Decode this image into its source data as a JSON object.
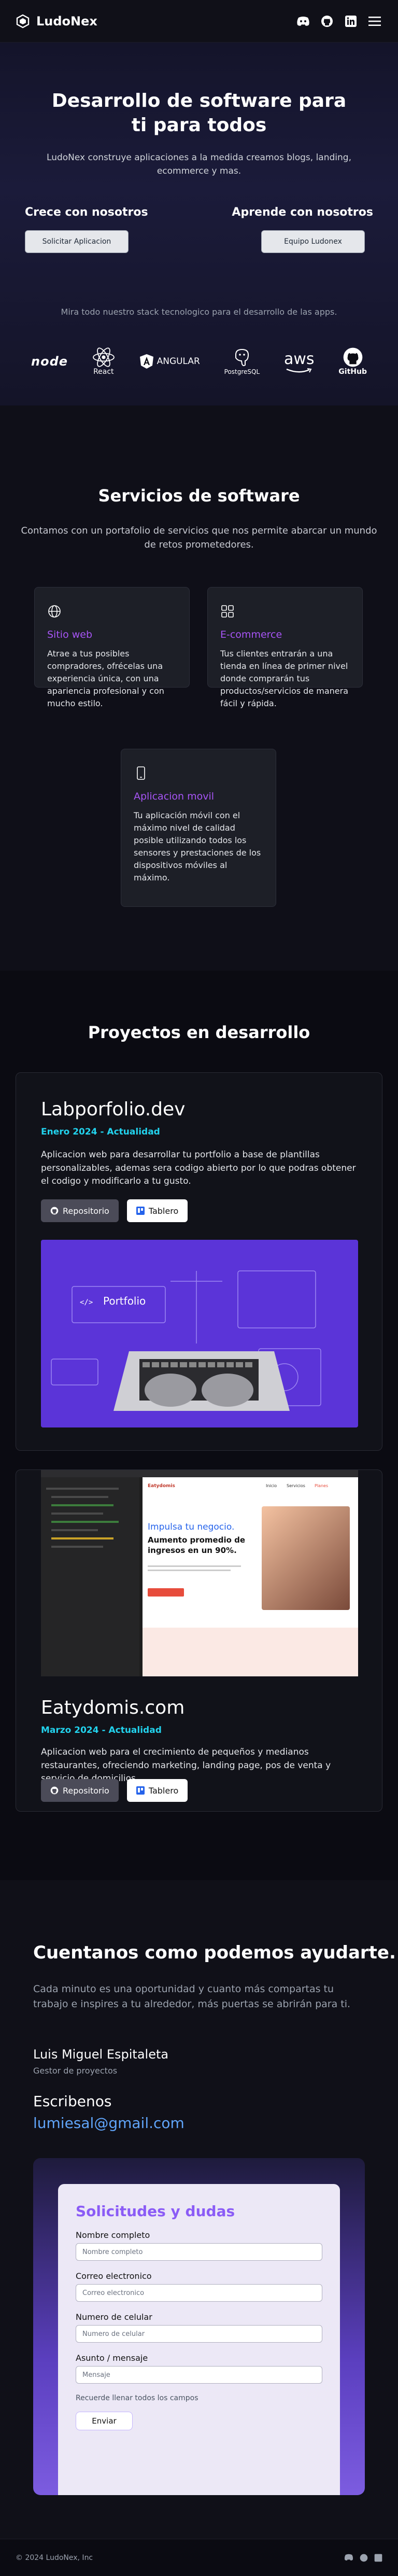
{
  "header": {
    "brand": "LudoNex",
    "icons": [
      "discord-icon",
      "github-icon",
      "linkedin-icon",
      "menu-icon"
    ]
  },
  "hero": {
    "title": "Desarrollo de software para ti para todos",
    "subtitle": "LudoNex construye aplicaciones a la medida creamos blogs, landing, ecommerce y mas.",
    "cta_left_title": "Crece con nosotros",
    "cta_left_button": "Solicitar Aplicacion",
    "cta_right_title": "Aprende con nosotros",
    "cta_right_button": "Equipo Ludonex",
    "stack_caption": "Mira todo nuestro stack tecnologico para el desarrollo de las apps.",
    "logos": [
      "node",
      "React",
      "ANGULAR",
      "PostgreSQL",
      "aws",
      "GitHub"
    ]
  },
  "services": {
    "title": "Servicios de software",
    "subtitle": "Contamos con un portafolio de servicios que nos permite abarcar un mundo de retos prometedores.",
    "items": [
      {
        "name": "Sitio web",
        "icon": "globe-icon",
        "desc": "Atrae a tus posibles compradores, ofrécelas una experiencia única, con una apariencia profesional y con mucho estilo."
      },
      {
        "name": "E-commerce",
        "icon": "grid-icon",
        "desc": "Tus clientes entrarán a una tienda en línea de primer nivel donde comprarán tus productos/servicios de manera fácil y rápida."
      },
      {
        "name": "Aplicacion movil",
        "icon": "phone-icon",
        "desc": "Tu aplicación móvil con el máximo nivel de calidad posible utilizando todos los sensores y prestaciones de los dispositivos móviles al máximo."
      }
    ]
  },
  "projects": {
    "title": "Proyectos en desarrollo",
    "items": [
      {
        "name": "Labporfolio.dev",
        "date": "Enero 2024 - Actualidad",
        "desc": "Aplicacion web para desarrollar tu portfolio a base de plantillas personalizables, ademas sera codigo abierto por lo que podras obtener el codigo y modificarlo a tu gusto.",
        "repo_label": "Repositorio",
        "board_label": "Tablero",
        "image_text": "Portfolio"
      },
      {
        "name": "Eatydomis.com",
        "date": "Marzo 2024 - Actualidad",
        "desc": "Aplicacion web para el crecimiento de pequeños y medianos restaurantes, ofreciendo marketing, landing page, pos de venta y servicio de domicilios.",
        "repo_label": "Repositorio",
        "board_label": "Tablero",
        "mock": {
          "headline": "Impulsa tu negocio.",
          "bold": "Aumento promedio de ingresos en un 90%.",
          "brand": "Eatydomis",
          "nav": [
            "Inicio",
            "Servicios",
            "Planes"
          ]
        }
      }
    ]
  },
  "contact": {
    "title": "Cuentanos como podemos ayudarte.",
    "subtitle": "Cada minuto es una oportunidad y cuanto más compartas tu trabajo e inspires a tu alrededor, más puertas se abrirán para ti.",
    "person_name": "Luis Miguel Espitaleta",
    "person_role": "Gestor de proyectos",
    "write_label": "Escribenos",
    "email": "lumiesal@gmail.com",
    "form": {
      "title": "Solicitudes y dudas",
      "fields": [
        {
          "label": "Nombre completo",
          "placeholder": "Nombre completo"
        },
        {
          "label": "Correo electronico",
          "placeholder": "Correo electronico"
        },
        {
          "label": "Numero de celular",
          "placeholder": "Numero de celular"
        },
        {
          "label": "Asunto / mensaje",
          "placeholder": "Mensaje"
        }
      ],
      "note": "Recuerde llenar todos los campos",
      "submit": "Enviar"
    }
  },
  "footer": {
    "copyright": "© 2024 LudoNex, Inc",
    "icons": [
      "discord-icon",
      "github-icon",
      "linkedin-icon"
    ]
  },
  "colors": {
    "accent": "#a855f7",
    "date": "#22d3ee",
    "link": "#60a5fa"
  }
}
